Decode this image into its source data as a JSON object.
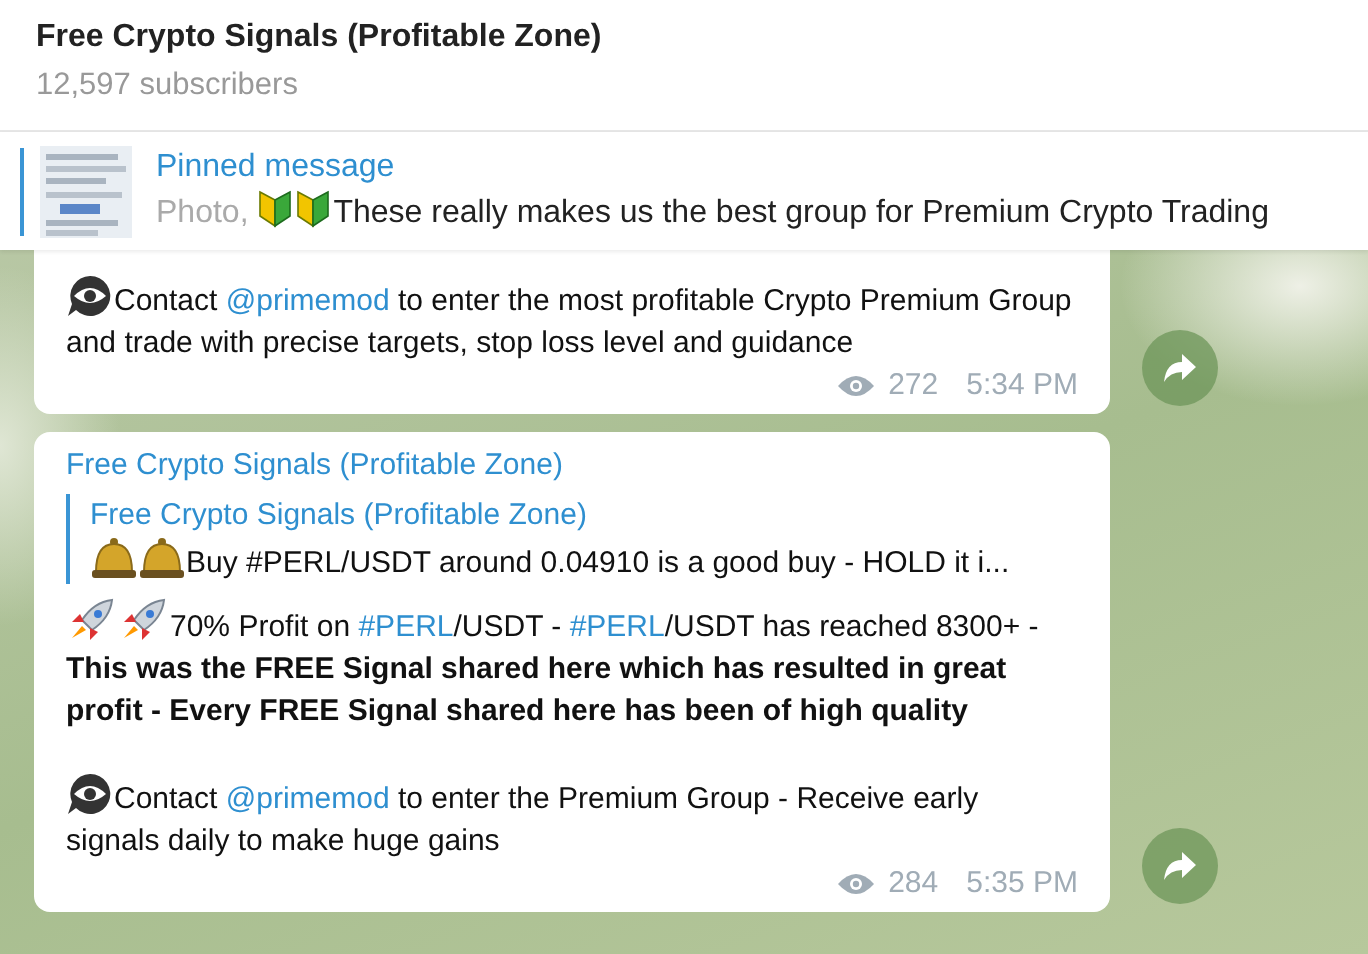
{
  "channel": {
    "title": "Free Crypto Signals (Profitable Zone)",
    "subscribers": "12,597 subscribers"
  },
  "pinned": {
    "label": "Pinned message",
    "media": "Photo,",
    "text": "These really makes us the best group for Premium Crypto Trading"
  },
  "messages": [
    {
      "paragraphs": [
        {
          "kind": "contact",
          "segments": [
            {
              "kind": "text",
              "text": "Contact "
            },
            {
              "kind": "link",
              "text": "@primemod"
            },
            {
              "kind": "text",
              "text": " to enter the most profitable Crypto Premium Group and trade with precise targets, stop loss level and guidance"
            }
          ]
        }
      ],
      "views": "272",
      "time": "5:34 PM"
    },
    {
      "author": "Free Crypto Signals (Profitable Zone)",
      "reply": {
        "author": "Free Crypto Signals (Profitable Zone)",
        "text": "Buy #PERL/USDT around 0.04910 is a good buy - HOLD it i..."
      },
      "paragraphs": [
        {
          "kind": "signal",
          "segments": [
            {
              "kind": "text",
              "text": "70% Profit on "
            },
            {
              "kind": "link",
              "text": "#PERL"
            },
            {
              "kind": "text",
              "text": "/USDT - "
            },
            {
              "kind": "link",
              "text": "#PERL"
            },
            {
              "kind": "text",
              "text": "/USDT has reached 8300+ - "
            },
            {
              "kind": "bold",
              "text": "This was the FREE Signal shared here which has resulted in great profit - Every FREE Signal shared here has been of high quality"
            }
          ]
        },
        {
          "kind": "contact",
          "segments": [
            {
              "kind": "text",
              "text": "Contact "
            },
            {
              "kind": "link",
              "text": "@primemod"
            },
            {
              "kind": "text",
              "text": " to enter the Premium Group - Receive early signals daily to make huge gains"
            }
          ]
        }
      ],
      "views": "284",
      "time": "5:35 PM"
    }
  ]
}
